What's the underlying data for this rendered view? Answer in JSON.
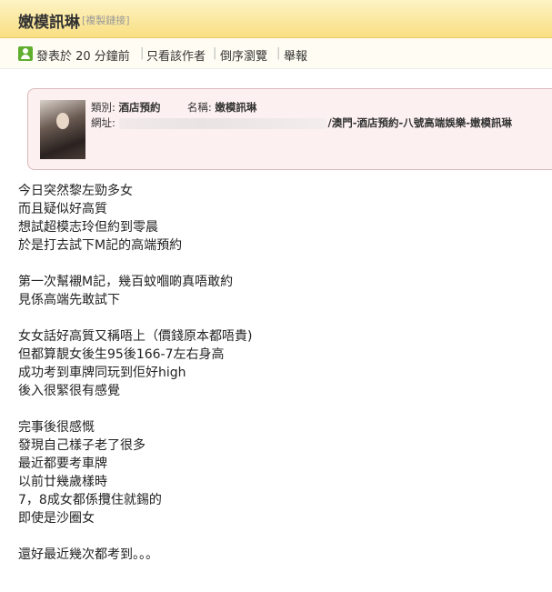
{
  "header": {
    "title": "嫩模訊琳",
    "copy_link": "[複製鏈接]"
  },
  "meta": {
    "posted": "發表於 20 分鐘前",
    "only_author": "只看該作者",
    "reverse": "倒序瀏覽",
    "report": "舉報"
  },
  "card": {
    "category_label": "類別:",
    "category_value": "酒店預約",
    "name_label": "名稱:",
    "name_value": "嫩模訊琳",
    "url_label": "網址:",
    "url_value": "/澳門-酒店預約-八號高端娛樂-嫩模訊琳"
  },
  "post": {
    "paragraphs": [
      [
        "今日突然黎左勁多女",
        "而且疑似好高質",
        "想試超模志玲但約到零晨",
        "於是打去試下M記的高端預約"
      ],
      [
        "第一次幫襯M記，幾百蚊嗰啲真唔敢約",
        "見係高端先敢試下"
      ],
      [
        "女女話好高質又稱唔上（價錢原本都唔貴)",
        "但都算靚女後生95後166-7左右身高",
        "成功考到車牌同玩到佢好high",
        "後入很緊很有感覺"
      ],
      [
        "完事後很感慨",
        "發現自己樣子老了很多",
        "最近都要考車牌",
        "以前廿幾歲樣時",
        "7，8成女都係攬住就錫的",
        "即使是沙圈女"
      ],
      [
        "還好最近幾次都考到。。。"
      ]
    ]
  }
}
